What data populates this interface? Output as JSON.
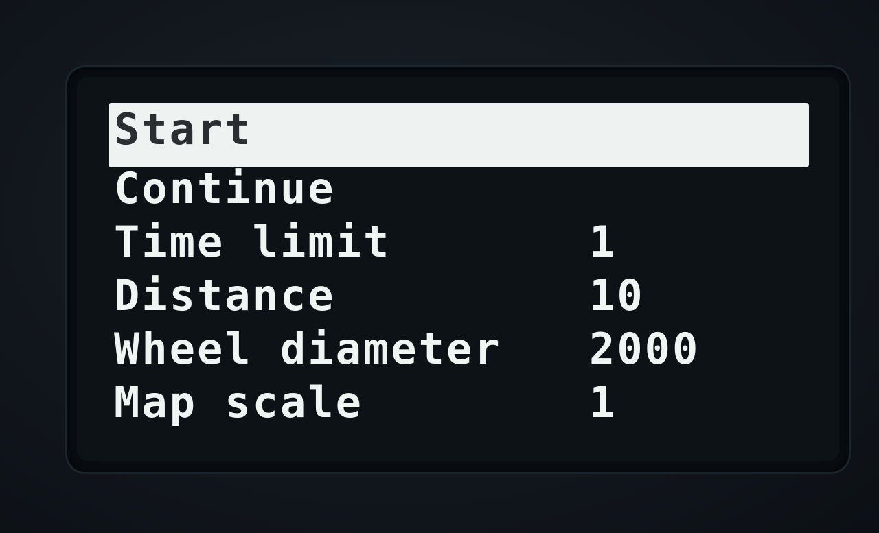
{
  "menu": {
    "items": [
      {
        "label": "Start",
        "value": "",
        "selected": true
      },
      {
        "label": "Continue",
        "value": ""
      },
      {
        "label": "Time limit",
        "value": "1"
      },
      {
        "label": "Distance",
        "value": "10"
      },
      {
        "label": "Wheel diameter",
        "value": "2000"
      },
      {
        "label": "Map scale",
        "value": "1"
      }
    ]
  },
  "colors": {
    "background": "#0d1217",
    "text": "#eef5f3",
    "highlight": "#eef3f2",
    "highlight_text": "#2a2e31"
  }
}
